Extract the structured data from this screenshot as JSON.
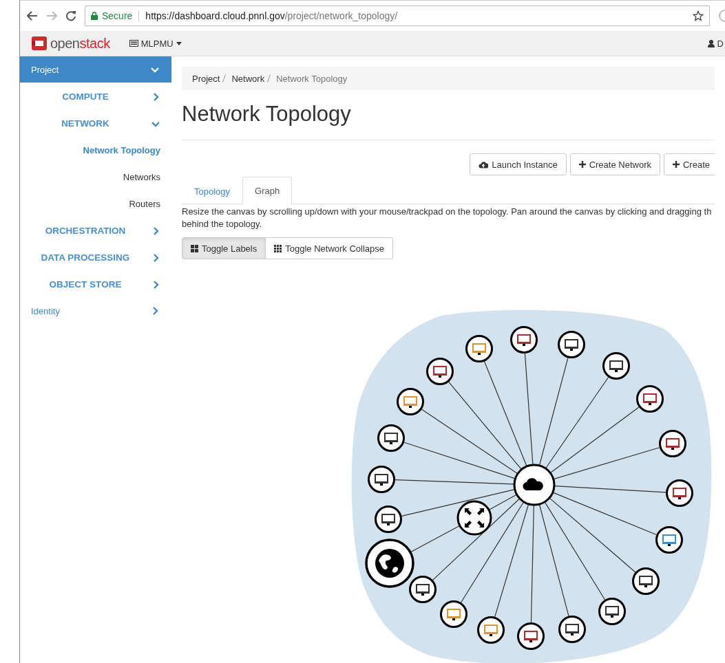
{
  "browser": {
    "secure_label": "Secure",
    "url_host": "https://dashboard.cloud.pnnl.gov",
    "url_path": "/project/network_topology/"
  },
  "topbar": {
    "brand_a": "open",
    "brand_b": "stack",
    "project": "MLPMU",
    "user": "D"
  },
  "sidebar": {
    "items": [
      {
        "label": "Project",
        "selected": true,
        "expanded": true,
        "children": [
          {
            "label": "COMPUTE",
            "expanded": false
          },
          {
            "label": "NETWORK",
            "expanded": true,
            "children": [
              {
                "label": "Network Topology",
                "selected": true
              },
              {
                "label": "Networks",
                "selected": false
              },
              {
                "label": "Routers",
                "selected": false
              }
            ]
          },
          {
            "label": "ORCHESTRATION",
            "expanded": false
          },
          {
            "label": "DATA PROCESSING",
            "expanded": false
          },
          {
            "label": "OBJECT STORE",
            "expanded": false
          }
        ]
      },
      {
        "label": "Identity",
        "selected": false,
        "expanded": false
      }
    ]
  },
  "breadcrumb": [
    "Project",
    "Network",
    "Network Topology"
  ],
  "title": "Network Topology",
  "actions": [
    "Launch Instance",
    "Create Network",
    "Create"
  ],
  "tabs": [
    {
      "label": "Topology",
      "selected": false
    },
    {
      "label": "Graph",
      "selected": true
    }
  ],
  "description": [
    "Resize the canvas by scrolling up/down with your mouse/trackpad on the topology. Pan around the canvas by clicking and dragging th",
    "behind the topology."
  ],
  "toggles": [
    {
      "label": "Toggle Labels",
      "selected": true
    },
    {
      "label": "Toggle Network Collapse",
      "selected": false
    }
  ],
  "topology": {
    "nodes": [
      {
        "kind": "external"
      },
      {
        "kind": "router"
      },
      {
        "kind": "network"
      },
      {
        "kind": "instance",
        "color": "#e0962a"
      },
      {
        "kind": "instance",
        "color": "#b02a30"
      },
      {
        "kind": "instance",
        "color": "#333333"
      },
      {
        "kind": "instance",
        "color": "#333333"
      },
      {
        "kind": "instance",
        "color": "#b02a30"
      },
      {
        "kind": "instance",
        "color": "#b02a30"
      },
      {
        "kind": "instance",
        "color": "#b02a30"
      },
      {
        "kind": "instance",
        "color": "#3a8fc8"
      },
      {
        "kind": "instance",
        "color": "#333333"
      },
      {
        "kind": "instance",
        "color": "#333333"
      },
      {
        "kind": "instance",
        "color": "#333333"
      },
      {
        "kind": "instance",
        "color": "#b02a30"
      },
      {
        "kind": "instance",
        "color": "#e0962a"
      },
      {
        "kind": "instance",
        "color": "#e0962a"
      },
      {
        "kind": "instance",
        "color": "#333333"
      },
      {
        "kind": "instance",
        "color": "#333333"
      },
      {
        "kind": "instance",
        "color": "#333333"
      },
      {
        "kind": "instance",
        "color": "#333333"
      },
      {
        "kind": "instance",
        "color": "#e0962a"
      },
      {
        "kind": "instance",
        "color": "#b02a30"
      }
    ]
  }
}
